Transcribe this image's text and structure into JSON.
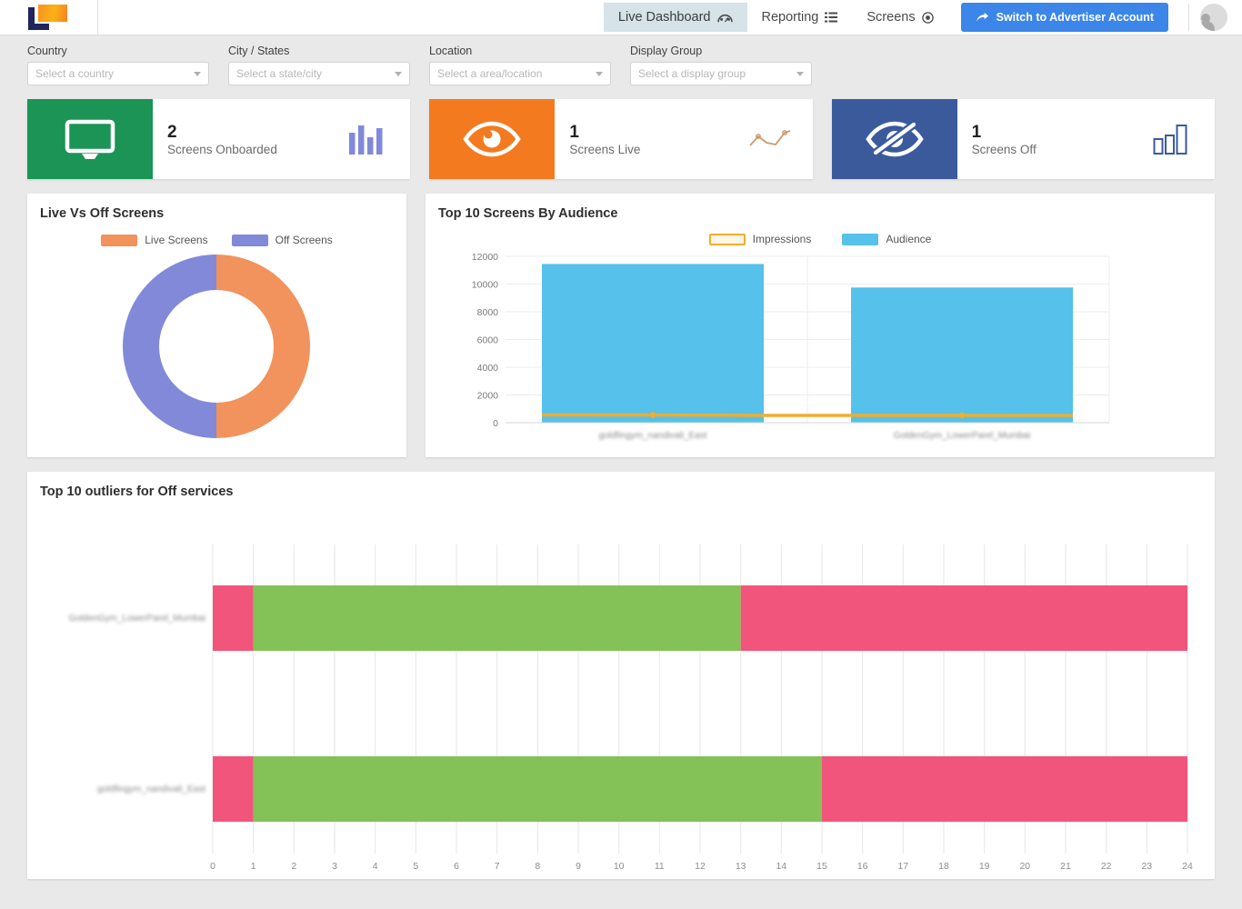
{
  "header": {
    "logo_name": "brand-logo",
    "nav": [
      {
        "label": "Live Dashboard",
        "icon": "speedometer-icon",
        "active": true
      },
      {
        "label": "Reporting",
        "icon": "list-icon",
        "active": false
      },
      {
        "label": "Screens",
        "icon": "target-icon",
        "active": false
      }
    ],
    "switch_button": {
      "label": "Switch to Advertiser Account",
      "icon": "share-arrow-icon",
      "color": "#3b86e8"
    },
    "avatar": "user-avatar"
  },
  "filters": [
    {
      "label": "Country",
      "placeholder": "Select a country",
      "value": ""
    },
    {
      "label": "City / States",
      "placeholder": "Select a state/city",
      "value": ""
    },
    {
      "label": "Location",
      "placeholder": "Select a area/location",
      "value": ""
    },
    {
      "label": "Display Group",
      "placeholder": "Select a display group",
      "value": ""
    }
  ],
  "kpis": [
    {
      "value": "2",
      "label": "Screens Onboarded",
      "color": "#1b9455",
      "icon": "monitor-icon",
      "spark": "bars-solid",
      "spark_color": "#8189d8"
    },
    {
      "value": "1",
      "label": "Screens Live",
      "color": "#f47a20",
      "icon": "eye-icon",
      "spark": "line",
      "spark_color": "#c99a6e"
    },
    {
      "value": "1",
      "label": "Screens Off",
      "color": "#3b5a9c",
      "icon": "eye-off-icon",
      "spark": "bars-outline",
      "spark_color": "#3b5a9c"
    }
  ],
  "donut_panel": {
    "title": "Live Vs Off Screens"
  },
  "bars_panel": {
    "title": "Top 10 Screens By Audience"
  },
  "outliers_panel": {
    "title": "Top 10 outliers for Off services"
  },
  "chart_data": [
    {
      "type": "pie",
      "title": "Live Vs Off Screens",
      "donut": true,
      "legend_position": "top",
      "labels": [
        "Live Screens",
        "Off Screens"
      ],
      "values": [
        1,
        1
      ],
      "percentages": [
        "50%",
        "50%"
      ],
      "value_labels": [
        "1",
        "1"
      ],
      "colors": [
        "#f2925c",
        "#8189d8"
      ]
    },
    {
      "type": "bar",
      "title": "Top 10 Screens By Audience",
      "legend_position": "top-right",
      "categories": [
        "goldfingym_nandivali_East",
        "GoldenGym_LowerParel_Mumbai"
      ],
      "categories_blurred": true,
      "series": [
        {
          "name": "Audience",
          "type": "bar",
          "values": [
            11450,
            9750
          ],
          "color": "#56c1ea"
        },
        {
          "name": "Impressions",
          "type": "line",
          "values": [
            560,
            520
          ],
          "color": "#f0ad2e"
        }
      ],
      "ylabel": "",
      "xlabel": "",
      "ylim": [
        0,
        12000
      ],
      "yticks": [
        0,
        2000,
        4000,
        6000,
        8000,
        10000,
        12000
      ],
      "grid": true
    },
    {
      "type": "bar",
      "orientation": "horizontal",
      "stacked": true,
      "title": "Top 10 outliers for Off services",
      "categories": [
        "GoldenGym_LowerParel_Mumbai",
        "goldfingym_nandivali_East"
      ],
      "categories_blurred": true,
      "xlim": [
        0,
        24
      ],
      "xticks": [
        0,
        1,
        2,
        3,
        4,
        5,
        6,
        7,
        8,
        9,
        10,
        11,
        12,
        13,
        14,
        15,
        16,
        17,
        18,
        19,
        20,
        21,
        22,
        23,
        24
      ],
      "grid": true,
      "series": [
        {
          "name": "segment-off-start",
          "color": "#f2557b",
          "values": [
            1,
            1
          ]
        },
        {
          "name": "segment-on",
          "color": "#84c257",
          "values": [
            12,
            14
          ]
        },
        {
          "name": "segment-off-end",
          "color": "#f2557b",
          "values": [
            11,
            9
          ]
        }
      ]
    }
  ]
}
